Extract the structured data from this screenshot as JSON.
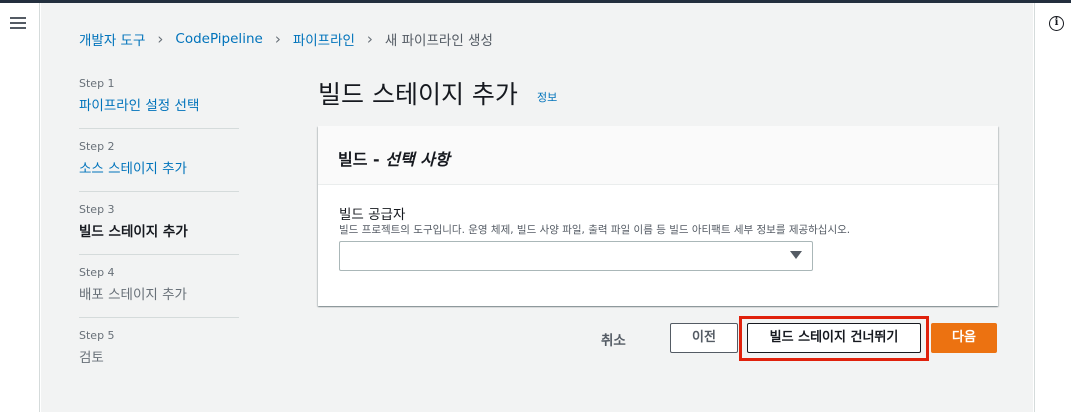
{
  "breadcrumb": {
    "items": [
      "개발자 도구",
      "CodePipeline",
      "파이프라인"
    ],
    "current": "새 파이프라인 생성"
  },
  "steps": [
    {
      "num": "Step 1",
      "label": "파이프라인 설정 선택"
    },
    {
      "num": "Step 2",
      "label": "소스 스테이지 추가"
    },
    {
      "num": "Step 3",
      "label": "빌드 스테이지 추가"
    },
    {
      "num": "Step 4",
      "label": "배포 스테이지 추가"
    },
    {
      "num": "Step 5",
      "label": "검토"
    }
  ],
  "page": {
    "title": "빌드 스테이지 추가",
    "info_link": "정보"
  },
  "panel": {
    "header_main": "빌드 - ",
    "header_optional": "선택 사항",
    "field_label": "빌드 공급자",
    "field_description": "빌드 프로젝트의 도구입니다. 운영 체제, 빌드 사양 파일, 출력 파일 이름 등 빌드 아티팩트 세부 정보를 제공하십시오.",
    "select_value": ""
  },
  "actions": {
    "cancel": "취소",
    "previous": "이전",
    "skip": "빌드 스테이지 건너뛰기",
    "next": "다음"
  },
  "colors": {
    "link": "#0073bb",
    "primary_button": "#ec7211",
    "highlight": "#e0210c",
    "background": "#f2f3f3"
  }
}
